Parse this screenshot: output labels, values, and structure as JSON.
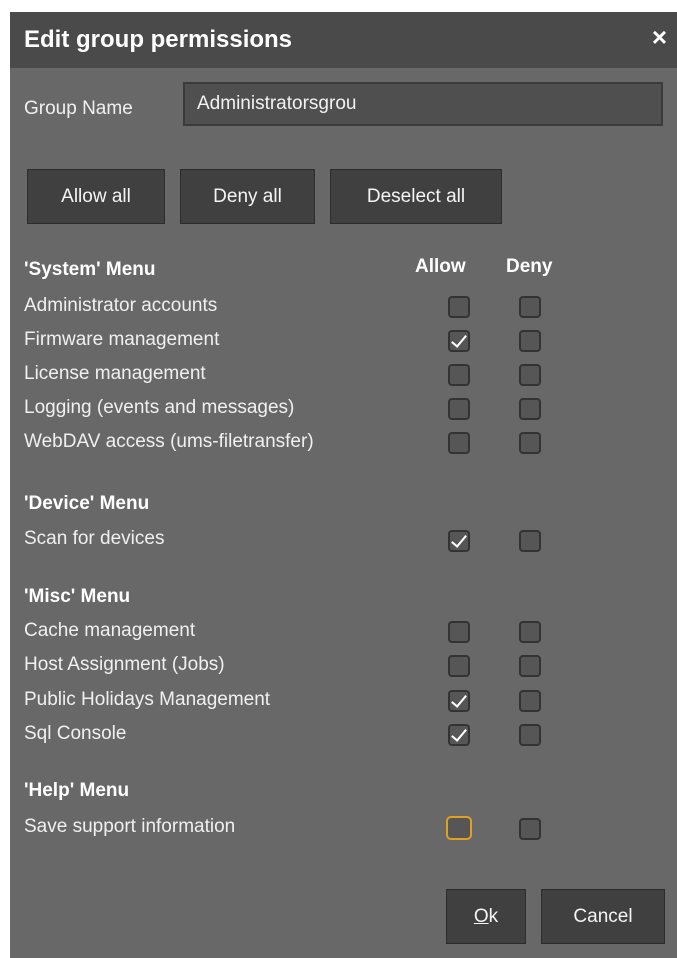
{
  "dialog": {
    "title": "Edit group permissions",
    "close_glyph": "×",
    "close_icon": "close-icon"
  },
  "group_name": {
    "label": "Group Name",
    "value": "Administratorsgrou"
  },
  "buttons": {
    "allow_all": "Allow all",
    "deny_all": "Deny all",
    "deselect_all": "Deselect all"
  },
  "columns": {
    "allow": "Allow",
    "deny": "Deny"
  },
  "sections": [
    {
      "title": "'System' Menu",
      "items": [
        {
          "label": "Administrator accounts",
          "allow": false,
          "deny": false
        },
        {
          "label": "Firmware management",
          "allow": true,
          "deny": false
        },
        {
          "label": "License management",
          "allow": false,
          "deny": false
        },
        {
          "label": "Logging (events and messages)",
          "allow": false,
          "deny": false
        },
        {
          "label": "WebDAV access (ums-filetransfer)",
          "allow": false,
          "deny": false
        }
      ]
    },
    {
      "title": "'Device' Menu",
      "items": [
        {
          "label": "Scan for devices",
          "allow": true,
          "deny": false
        }
      ]
    },
    {
      "title": "'Misc' Menu",
      "items": [
        {
          "label": "Cache management",
          "allow": false,
          "deny": false
        },
        {
          "label": "Host Assignment (Jobs)",
          "allow": false,
          "deny": false
        },
        {
          "label": "Public Holidays Management",
          "allow": true,
          "deny": false
        },
        {
          "label": "Sql Console",
          "allow": true,
          "deny": false
        }
      ]
    },
    {
      "title": "'Help' Menu",
      "items": [
        {
          "label": "Save support information",
          "allow": false,
          "deny": false,
          "focused": true
        }
      ]
    }
  ],
  "footer": {
    "ok_mnemonic": "O",
    "ok_rest": "k",
    "cancel": "Cancel"
  },
  "colors": {
    "dialog_bg": "#686868",
    "titlebar_bg": "#4a4a4a",
    "focus_ring": "#e0a020"
  }
}
